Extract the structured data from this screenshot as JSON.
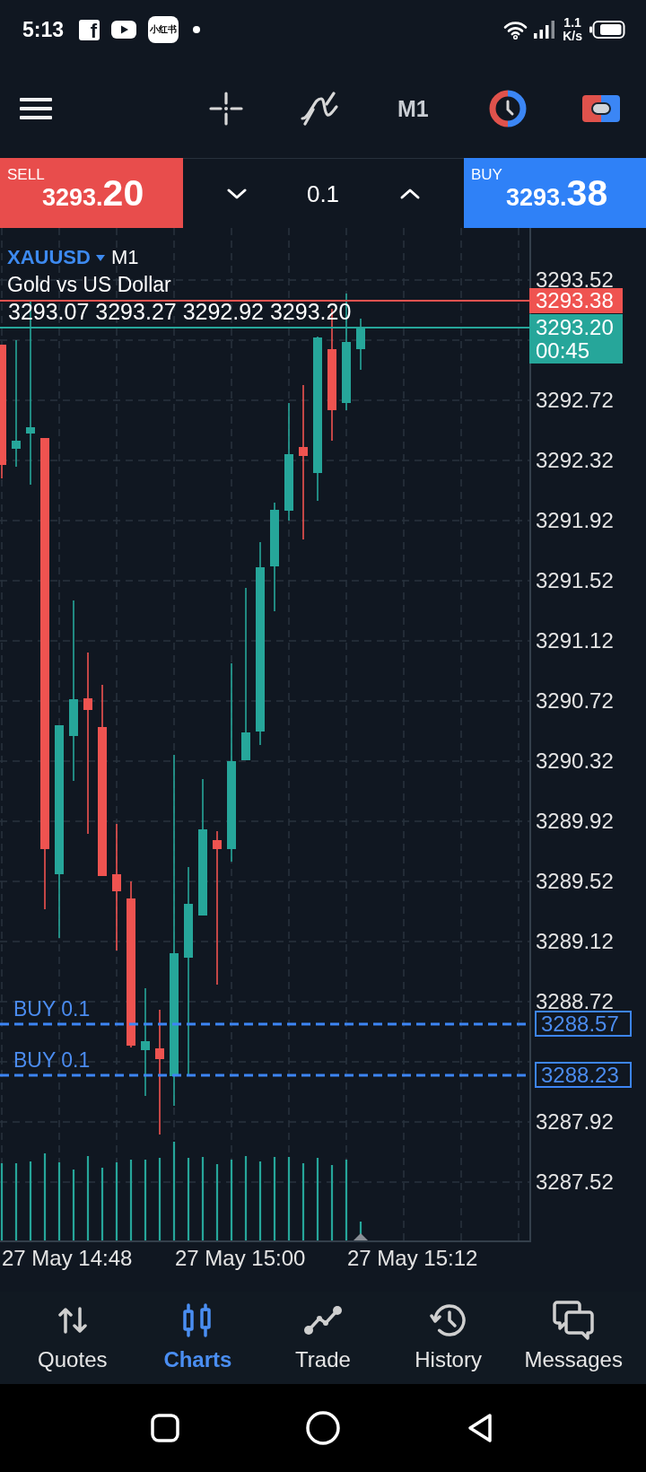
{
  "status_bar": {
    "time": "5:13",
    "notifications": [
      {
        "kind": "letter_tile",
        "text": "f"
      },
      {
        "kind": "play_tile"
      },
      {
        "kind": "text_tile",
        "text": "小红书"
      },
      {
        "kind": "dot"
      }
    ],
    "network_speed": {
      "value": "1.1",
      "unit": "K/s"
    }
  },
  "toolbar": {
    "timeframe": "M1"
  },
  "trade_panel": {
    "sell": {
      "label": "SELL",
      "price": "3293.20"
    },
    "volume": "0.1",
    "buy": {
      "label": "BUY",
      "price": "3293.38"
    }
  },
  "chart": {
    "symbol": "XAUUSD",
    "timeframe": "M1",
    "description": "Gold vs US Dollar",
    "ohlc": "3293.07 3293.27 3292.92 3293.20",
    "ask_tag": "3293.38",
    "bid_tag": {
      "price": "3293.20",
      "countdown": "00:45"
    },
    "price_axis": [
      "3293.52",
      "3292.72",
      "3292.32",
      "3291.92",
      "3291.52",
      "3291.12",
      "3290.72",
      "3290.32",
      "3289.92",
      "3289.52",
      "3289.12",
      "3288.72",
      "3287.92",
      "3287.52"
    ],
    "orders": [
      {
        "label": "BUY 0.1",
        "price": "3288.57"
      },
      {
        "label": "BUY 0.1",
        "price": "3288.23"
      }
    ],
    "time_axis": [
      "27 May 14:48",
      "27 May 15:00",
      "27 May 15:12"
    ]
  },
  "bottom_nav": [
    {
      "label": "Quotes",
      "selected": false
    },
    {
      "label": "Charts",
      "selected": true
    },
    {
      "label": "Trade",
      "selected": false
    },
    {
      "label": "History",
      "selected": false
    },
    {
      "label": "Messages",
      "selected": false
    }
  ]
}
